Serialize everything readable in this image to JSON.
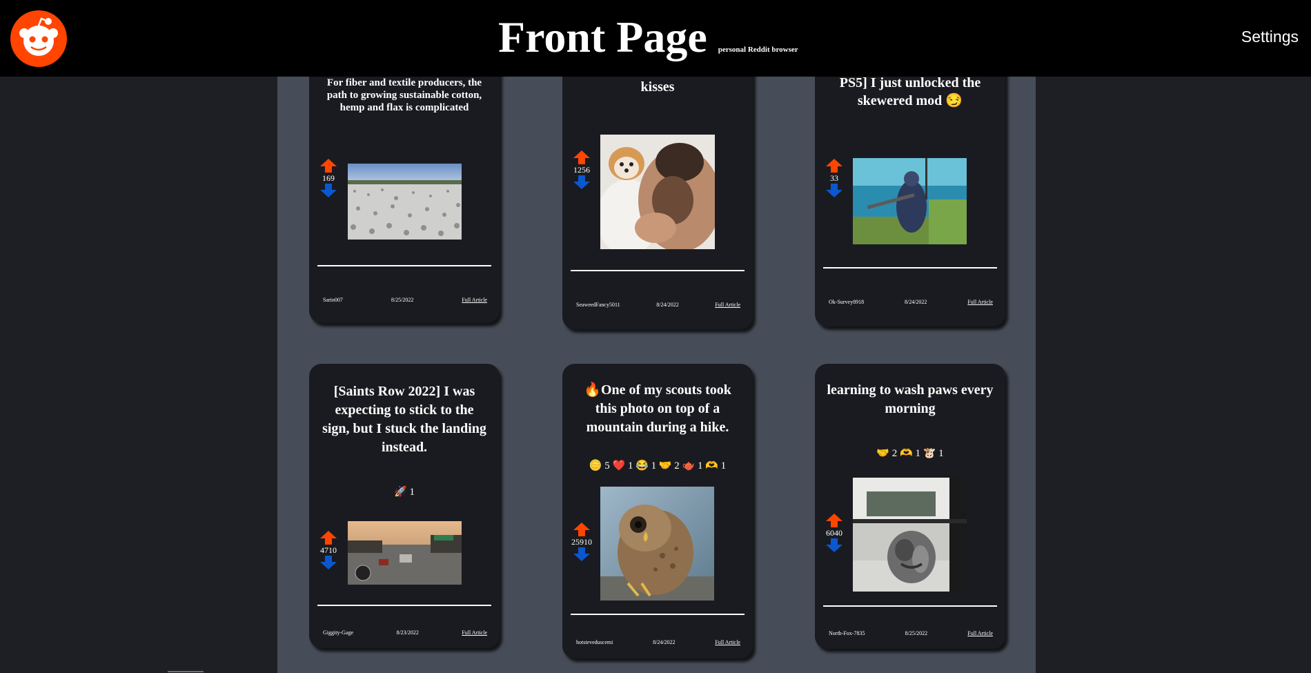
{
  "header": {
    "logo_icon": "reddit-alien-icon",
    "title": "Front Page",
    "subtitle": "personal Reddit browser",
    "settings_label": "Settings"
  },
  "colors": {
    "upvote": "#ff4500",
    "downvote": "#0b57d0",
    "card_bg": "#1a1b20",
    "main_bg": "#474d58",
    "page_bg": "#1d1f25"
  },
  "posts": [
    {
      "title": "For fiber and textile producers, the path to growing sustainable cotton, hemp and flax is complicated",
      "score": "169",
      "author": "Sarin007",
      "date": "8/25/2022",
      "link": "Full Article"
    },
    {
      "title": "kisses",
      "score": "1256",
      "author": "SeaweedFancy5011",
      "date": "8/24/2022",
      "link": "Full Article"
    },
    {
      "title": "PS5] I just unlocked the skewered mod 😏",
      "score": "33",
      "author": "Ok-Survey8918",
      "date": "8/24/2022",
      "link": "Full Article"
    },
    {
      "title": "[Saints Row 2022] I was expecting to stick to the sign, but I stuck the landing instead.",
      "awards": "🚀 1",
      "score": "4710",
      "author": "Giggity-Gage",
      "date": "8/23/2022",
      "link": "Full Article"
    },
    {
      "title": "🔥One of my scouts took this photo on top of a mountain during a hike.",
      "awards": "🪙 5 ❤️ 1 😂 1 🤝 2 🫖 1 🫶 1",
      "score": "25910",
      "author": "hotsteveduscemi",
      "date": "8/24/2022",
      "link": "Full Article"
    },
    {
      "title": "learning to wash paws every morning",
      "awards": "🤝 2 🫶 1 🐮 1",
      "score": "6040",
      "author": "North-Fox-7835",
      "date": "8/25/2022",
      "link": "Full Article"
    }
  ]
}
